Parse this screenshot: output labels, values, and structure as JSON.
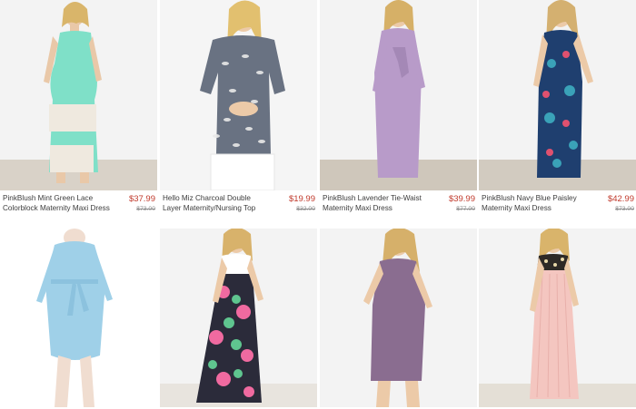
{
  "products": [
    {
      "name": "PinkBlush Mint Green Lace Colorblock Maternity Maxi Dress",
      "price": "$37.99",
      "original_price": "$73.00"
    },
    {
      "name": "Hello Miz Charcoal Double Layer Maternity/Nursing Top",
      "price": "$19.99",
      "original_price": "$32.00"
    },
    {
      "name": "PinkBlush Lavender Tie-Waist Maternity Maxi Dress",
      "price": "$39.99",
      "original_price": "$77.00"
    },
    {
      "name": "PinkBlush Navy Blue Paisley Maternity Maxi Dress",
      "price": "$42.99",
      "original_price": "$73.00"
    }
  ],
  "colors": {
    "sale_price": "#c0392b",
    "original_price": "#8a8a8a",
    "product_name": "#3c3c3c"
  }
}
